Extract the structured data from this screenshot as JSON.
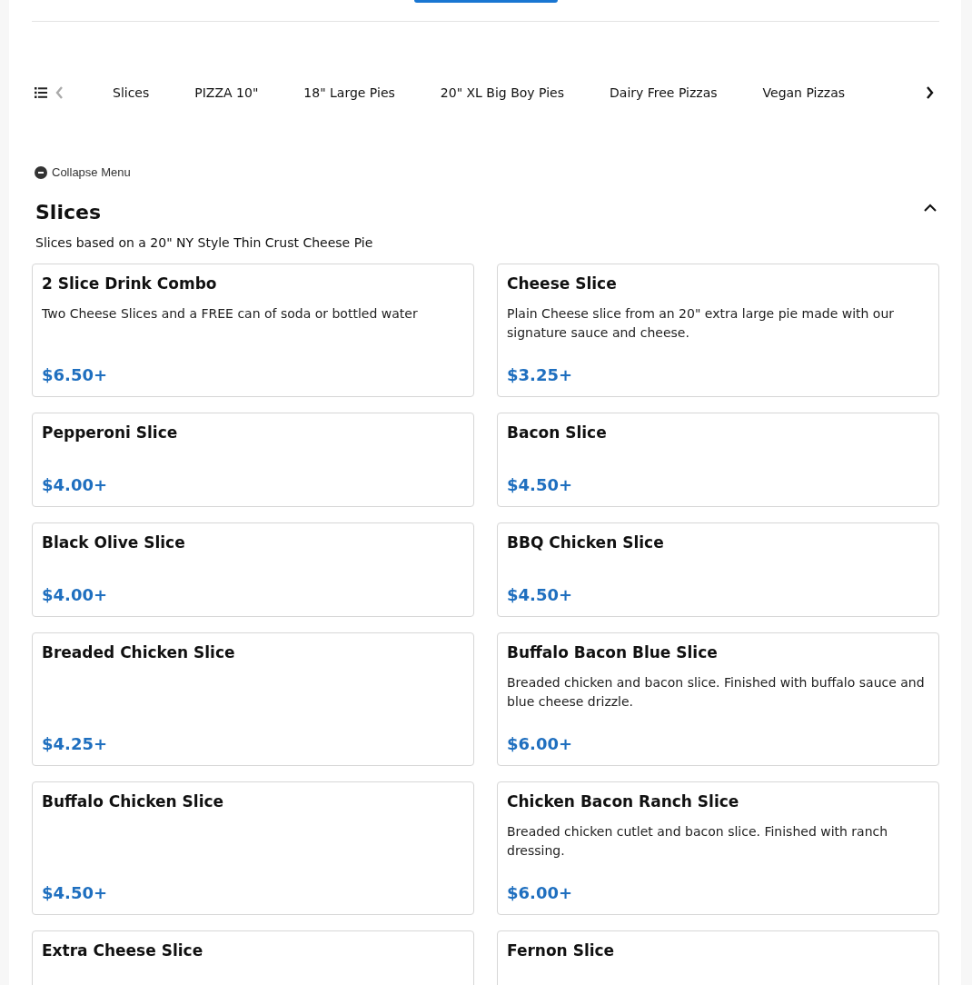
{
  "category_tabs": [
    {
      "label": "Slices",
      "selected": false
    },
    {
      "label": "PIZZA 10\"",
      "selected": false
    },
    {
      "label": "18\" Large Pies",
      "selected": false
    },
    {
      "label": "20\" XL Big Boy Pies",
      "selected": false
    },
    {
      "label": "Dairy Free Pizzas",
      "selected": false
    },
    {
      "label": "Vegan Pizzas",
      "selected": false
    }
  ],
  "tab_scroll": {
    "previous_disabled": true,
    "next_disabled": false
  },
  "collapse_menu": {
    "label": "Collapse Menu"
  },
  "section": {
    "title": "Slices",
    "subtitle": "Slices based on a 20\" NY Style Thin Crust Cheese Pie",
    "expanded": true,
    "items": [
      {
        "name": "2 Slice Drink Combo",
        "description": "Two Cheese Slices and a FREE can of soda or bottled water",
        "price": "$6.50+"
      },
      {
        "name": "Cheese Slice",
        "description": "Plain Cheese slice from an 20\" extra large pie made with our signature sauce and cheese.",
        "price": "$3.25+"
      },
      {
        "name": "Pepperoni Slice",
        "price": "$4.00+"
      },
      {
        "name": "Bacon Slice",
        "price": "$4.50+"
      },
      {
        "name": "Black Olive Slice",
        "price": "$4.00+"
      },
      {
        "name": "BBQ Chicken Slice",
        "price": "$4.50+"
      },
      {
        "name": "Breaded Chicken Slice",
        "price": "$4.25+"
      },
      {
        "name": "Buffalo Bacon Blue Slice",
        "description": "Breaded chicken and bacon slice. Finished with buffalo sauce and blue cheese drizzle.",
        "price": "$6.00+"
      },
      {
        "name": "Buffalo Chicken Slice",
        "price": "$4.50+"
      },
      {
        "name": "Chicken Bacon Ranch Slice",
        "description": "Breaded chicken cutlet and bacon slice. Finished with ranch dressing.",
        "price": "$6.00+"
      },
      {
        "name": "Extra Cheese Slice"
      },
      {
        "name": "Fernon Slice"
      }
    ]
  }
}
